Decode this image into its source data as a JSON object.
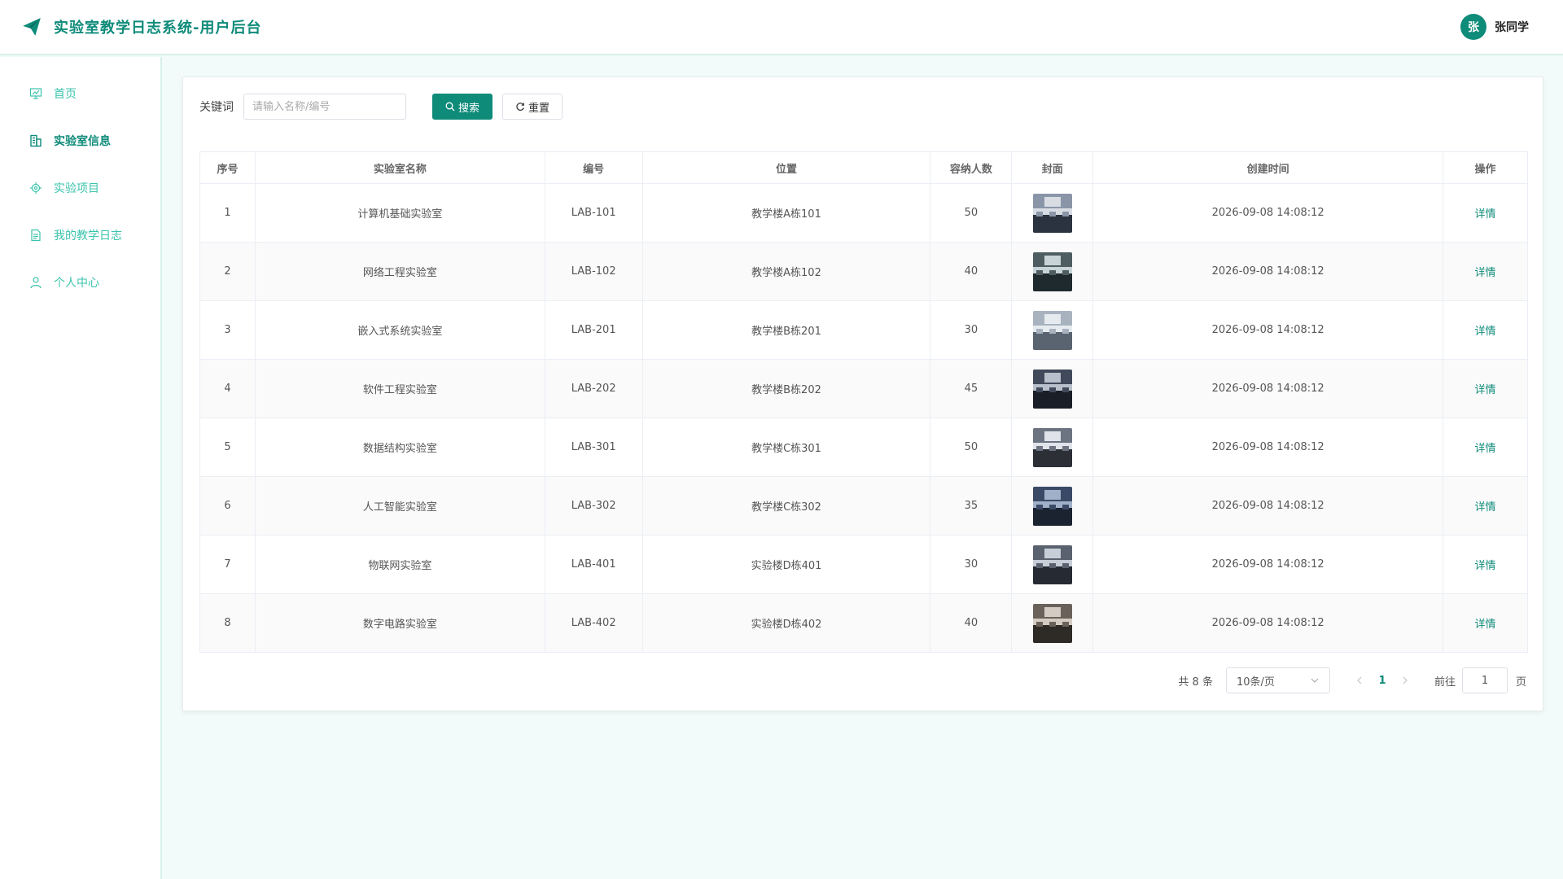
{
  "app": {
    "title": "实验室教学日志系统-用户后台"
  },
  "user": {
    "avatar_text": "张",
    "name": "张同学"
  },
  "sidebar": {
    "items": [
      {
        "label": "首页",
        "icon": "presentation-chart-icon",
        "active": false
      },
      {
        "label": "实验室信息",
        "icon": "building-icon",
        "active": true
      },
      {
        "label": "实验项目",
        "icon": "gear-icon",
        "active": false
      },
      {
        "label": "我的教学日志",
        "icon": "document-icon",
        "active": false
      },
      {
        "label": "个人中心",
        "icon": "user-icon",
        "active": false
      }
    ]
  },
  "search": {
    "label": "关键词",
    "placeholder": "请输入名称/编号",
    "value": "",
    "search_label": "搜索",
    "reset_label": "重置"
  },
  "table": {
    "headers": [
      "序号",
      "实验室名称",
      "编号",
      "位置",
      "容纳人数",
      "封面",
      "创建时间",
      "操作"
    ],
    "rows": [
      {
        "index": "1",
        "name": "计算机基础实验室",
        "code": "LAB-101",
        "location": "教学楼A栋101",
        "capacity": "50",
        "created": "2026-09-08 14:08:12",
        "action": "详情"
      },
      {
        "index": "2",
        "name": "网络工程实验室",
        "code": "LAB-102",
        "location": "教学楼A栋102",
        "capacity": "40",
        "created": "2026-09-08 14:08:12",
        "action": "详情"
      },
      {
        "index": "3",
        "name": "嵌入式系统实验室",
        "code": "LAB-201",
        "location": "教学楼B栋201",
        "capacity": "30",
        "created": "2026-09-08 14:08:12",
        "action": "详情"
      },
      {
        "index": "4",
        "name": "软件工程实验室",
        "code": "LAB-202",
        "location": "教学楼B栋202",
        "capacity": "45",
        "created": "2026-09-08 14:08:12",
        "action": "详情"
      },
      {
        "index": "5",
        "name": "数据结构实验室",
        "code": "LAB-301",
        "location": "教学楼C栋301",
        "capacity": "50",
        "created": "2026-09-08 14:08:12",
        "action": "详情"
      },
      {
        "index": "6",
        "name": "人工智能实验室",
        "code": "LAB-302",
        "location": "教学楼C栋302",
        "capacity": "35",
        "created": "2026-09-08 14:08:12",
        "action": "详情"
      },
      {
        "index": "7",
        "name": "物联网实验室",
        "code": "LAB-401",
        "location": "实验楼D栋401",
        "capacity": "30",
        "created": "2026-09-08 14:08:12",
        "action": "详情"
      },
      {
        "index": "8",
        "name": "数字电路实验室",
        "code": "LAB-402",
        "location": "实验楼D栋402",
        "capacity": "40",
        "created": "2026-09-08 14:08:12",
        "action": "详情"
      }
    ]
  },
  "pagination": {
    "total_text": "共 8 条",
    "page_size_label": "10条/页",
    "current_page": "1",
    "goto_label": "前往",
    "goto_value": "1",
    "page_unit": "页"
  },
  "colors": {
    "accent": "#0f8b7a",
    "accent_light": "#3cc3ad",
    "background": "#f2fbfa"
  }
}
